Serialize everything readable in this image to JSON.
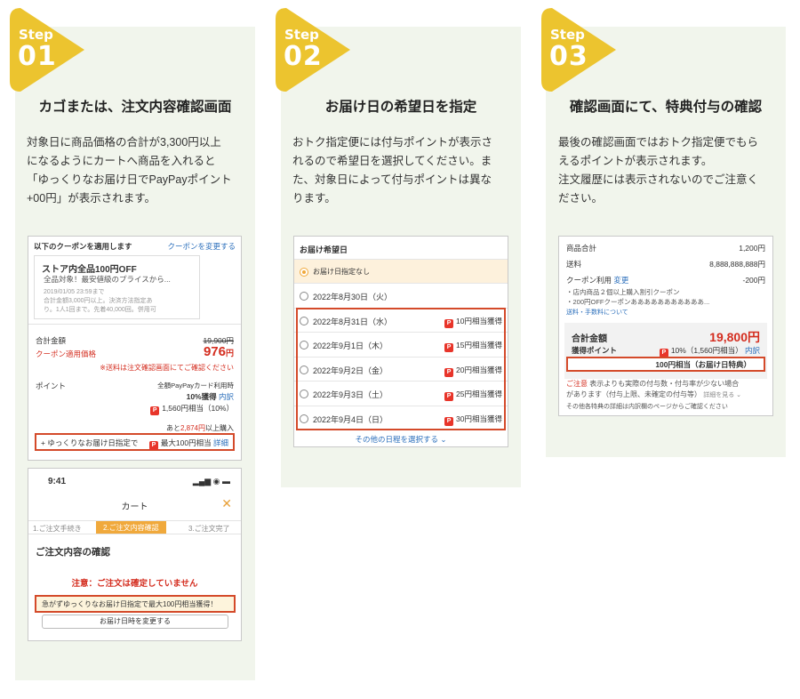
{
  "steps": [
    {
      "step_word": "Step",
      "step_num": "01",
      "title": "カゴまたは、注文内容確認画面",
      "desc_lines": [
        "対象日に商品価格の合計が3,300円以上",
        "になるようにカートへ商品を入れると",
        "「ゆっくりなお届け日でPayPayポイント",
        "+00円」が表示されます。"
      ]
    },
    {
      "step_word": "Step",
      "step_num": "02",
      "title": "お届け日の希望日を指定",
      "desc_lines": [
        "おトク指定便には付与ポイントが表示さ",
        "れるので希望日を選択してください。ま",
        "た、対象日によって付与ポイントは異な",
        "ります。"
      ]
    },
    {
      "step_word": "Step",
      "step_num": "03",
      "title": "確認画面にて、特典付与の確認",
      "desc_lines": [
        "最後の確認画面ではおトク指定便でもら",
        "えるポイントが表示されます。",
        "注文履歴には表示されないのでご注意く",
        "ださい。"
      ]
    }
  ],
  "coupon_screen": {
    "header": "以下のクーポンを適用します",
    "change_link": "クーポンを変更する",
    "coupon_name": "ストア内全品100円OFF",
    "coupon_sub": "全品対象！最安値級のプライスから...",
    "coupon_date": "2019/01/05 23:59まで",
    "coupon_note1": "合計金額3,000円以上。決済方法指定あ",
    "coupon_note2": "り。1人1回まで。先着40,000回。併用可",
    "total_label": "合計金額",
    "total_old": "19,900円",
    "coupon_price_label": "クーポン適用価格",
    "coupon_price": "976",
    "yen": "円",
    "shipping_note": "※送料は注文確認画面にてご確認ください",
    "point_label": "ポイント",
    "point_card": "全額PayPayカード利用時",
    "point_rate": "10%獲得",
    "point_detail": "内訳",
    "point_amount": "1,560円相当（10%）",
    "more_prefix": "あと",
    "more_amount": "2,874円",
    "more_suffix": "以上購入",
    "slow_label": "+ ゆっくりなお届け日指定で",
    "slow_points": "最大100円相当",
    "slow_detail": "詳細"
  },
  "phone_screen": {
    "time": "9:41",
    "status": "▂▄▆ ◉ ▬",
    "cart_title": "カート",
    "close": "✕",
    "step1": "1.ご注文手続き",
    "step2": "2.ご注文内容確認",
    "step3": "3.ご注文完了",
    "confirm_title": "ご注文内容の確認",
    "warning": "注意：ご注文は確定していません",
    "banner": "急がずゆっくりなお届け日指定で最大100円相当獲得！",
    "change_date_btn": "お届け日時を変更する"
  },
  "delivery_screen": {
    "header": "お届け希望日",
    "options": [
      {
        "label": "お届け日指定なし",
        "points": ""
      },
      {
        "label": "2022年8月30日（火）",
        "points": ""
      },
      {
        "label": "2022年8月31日（水）",
        "points": "10円相当獲得"
      },
      {
        "label": "2022年9月1日（木）",
        "points": "15円相当獲得"
      },
      {
        "label": "2022年9月2日（金）",
        "points": "20円相当獲得"
      },
      {
        "label": "2022年9月3日（土）",
        "points": "25円相当獲得"
      },
      {
        "label": "2022年9月4日（日）",
        "points": "30円相当獲得"
      }
    ],
    "more_dates": "その他の日程を選択する ⌄"
  },
  "confirm_screen": {
    "subtotal_label": "商品合計",
    "subtotal": "1,200円",
    "shipping_label": "送料",
    "shipping": "8,888,888,888円",
    "coupon_label": "クーポン利用",
    "coupon_change": "変更",
    "coupon_value": "-200円",
    "coupon_note1": "・店内商品２個以上購入割引クーポン",
    "coupon_note2": "・200円OFFクーポンあああああああああああ...",
    "fee_link": "送料・手数料について",
    "total_label": "合計金額",
    "total": "19,800円",
    "points_label": "獲得ポイント",
    "points_value": "10%（1,560円相当）",
    "points_detail": "内訳",
    "bonus": "100円相当（お届け日特典）",
    "caution_label": "ご注意",
    "caution_line1": "表示よりも実際の付与数・付与率が少ない場合",
    "caution_line2": "があります（付与上限、未確定の付与等）",
    "caution_more": "詳細を見る ⌄",
    "other_note": "その他各特典の詳細は内訳欄のページからご確認ください"
  },
  "colors": {
    "accent_yellow": "#ecc42f",
    "panel_bg": "#f1f5ec",
    "highlight_red": "#d44a2a",
    "paypay_red": "#e8352a",
    "link_blue": "#2a6ebb",
    "step_orange": "#f0a93c"
  },
  "icons": {
    "paypay": "paypay-icon",
    "close": "close-icon",
    "radio": "radio-icon",
    "chevron": "chevron-down-icon"
  }
}
